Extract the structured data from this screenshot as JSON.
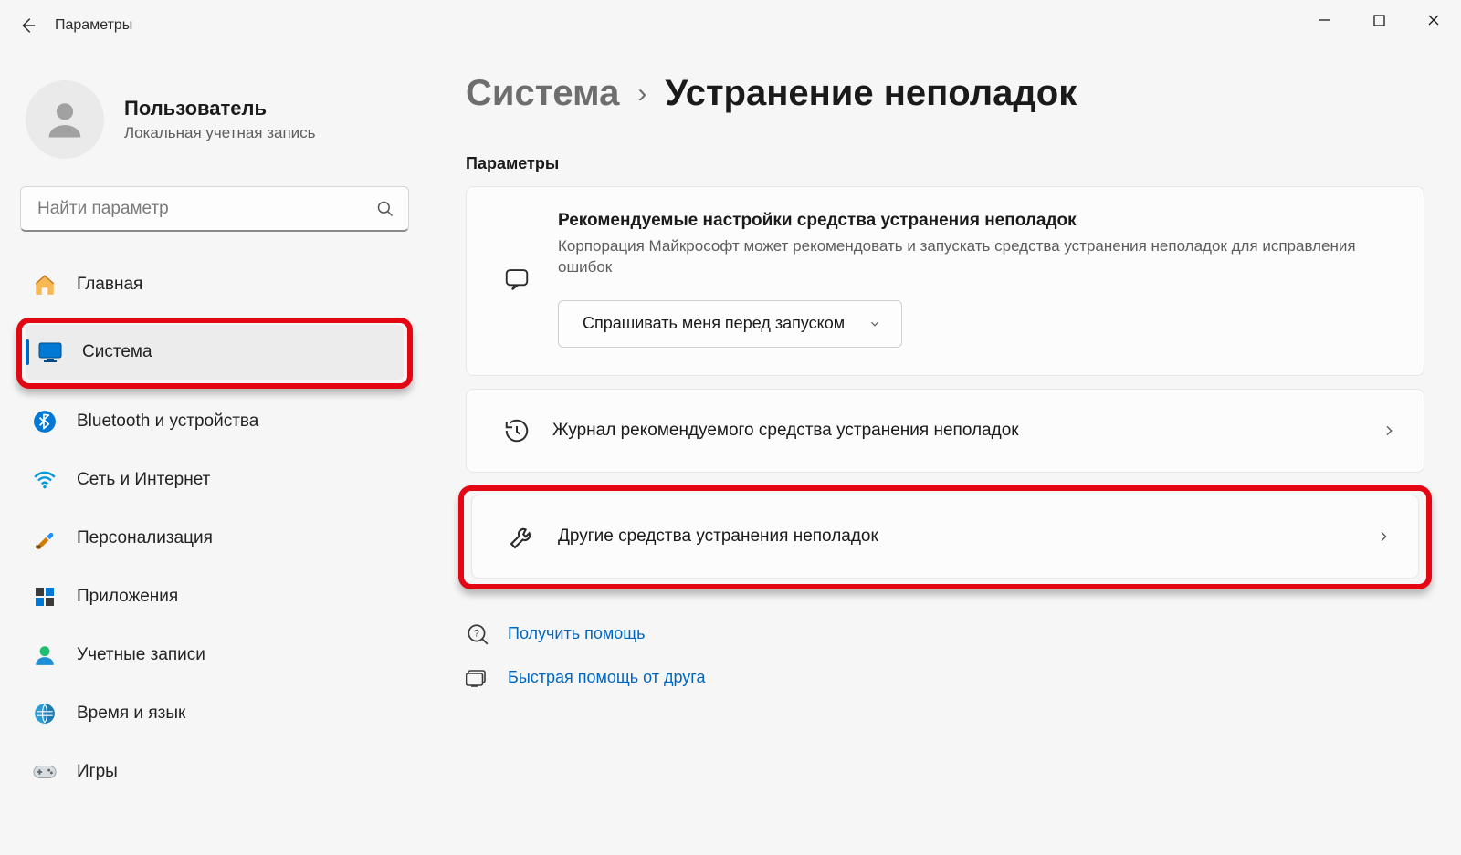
{
  "window": {
    "app_title": "Параметры"
  },
  "user": {
    "name": "Пользователь",
    "subtitle": "Локальная учетная запись"
  },
  "search": {
    "placeholder": "Найти параметр"
  },
  "sidebar": {
    "items": [
      {
        "id": "home",
        "label": "Главная",
        "icon": "home-icon"
      },
      {
        "id": "system",
        "label": "Система",
        "icon": "system-icon",
        "selected": true,
        "highlighted": true
      },
      {
        "id": "bluetooth",
        "label": "Bluetooth и устройства",
        "icon": "bluetooth-icon"
      },
      {
        "id": "network",
        "label": "Сеть и Интернет",
        "icon": "wifi-icon"
      },
      {
        "id": "personalize",
        "label": "Персонализация",
        "icon": "personalize-icon"
      },
      {
        "id": "apps",
        "label": "Приложения",
        "icon": "apps-icon"
      },
      {
        "id": "accounts",
        "label": "Учетные записи",
        "icon": "accounts-icon"
      },
      {
        "id": "time",
        "label": "Время и язык",
        "icon": "time-icon"
      },
      {
        "id": "gaming",
        "label": "Игры",
        "icon": "gaming-icon"
      }
    ]
  },
  "breadcrumb": {
    "root": "Система",
    "sep": "›",
    "current": "Устранение неполадок"
  },
  "section": {
    "title": "Параметры"
  },
  "recommended": {
    "title": "Рекомендуемые настройки средства устранения неполадок",
    "description": "Корпорация Майкрософт может рекомендовать и запускать средства устранения неполадок для исправления ошибок",
    "dropdown_value": "Спрашивать меня перед запуском"
  },
  "rows": [
    {
      "id": "history",
      "label": "Журнал рекомендуемого средства устранения неполадок",
      "icon": "history-icon",
      "highlighted": false
    },
    {
      "id": "other",
      "label": "Другие средства устранения неполадок",
      "icon": "wrench-icon",
      "highlighted": true
    }
  ],
  "help_links": [
    {
      "id": "get_help",
      "label": "Получить помощь",
      "icon": "help-icon"
    },
    {
      "id": "quick_assist",
      "label": "Быстрая помощь от друга",
      "icon": "quick-assist-icon"
    }
  ]
}
